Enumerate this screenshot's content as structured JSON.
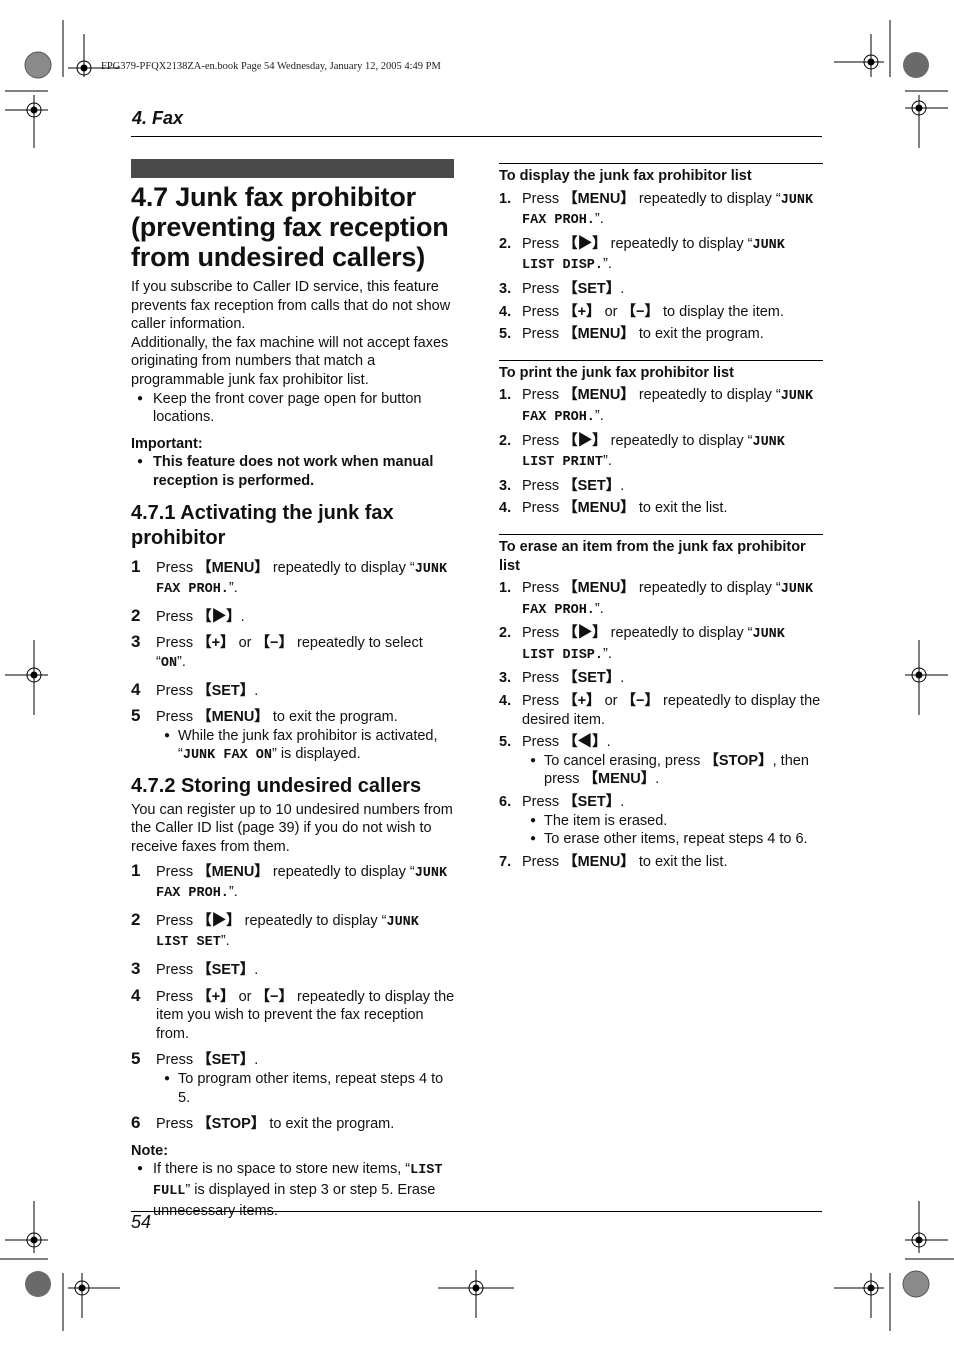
{
  "slug": "FPG379-PFQX2138ZA-en.book  Page 54  Wednesday, January 12, 2005  4:49 PM",
  "chapter": "4. Fax",
  "page_number": "54",
  "section": {
    "title": "4.7 Junk fax prohibitor (preventing fax reception from undesired callers)",
    "intro1": "If you subscribe to Caller ID service, this feature prevents fax reception from calls that do not show caller information.",
    "intro2": "Additionally, the fax machine will not accept faxes originating from numbers that match a programmable junk fax prohibitor list.",
    "bullet": "Keep the front cover page open for button locations.",
    "important_label": "Important:",
    "important_text": "This feature does not work when manual reception is performed."
  },
  "sub1": {
    "title": "4.7.1 Activating the junk fax prohibitor",
    "steps": [
      {
        "n": "1",
        "a": "Press ",
        "k": "【MENU】",
        "b": " repeatedly to display “",
        "lcd": "JUNK FAX PROH.",
        "c": "”."
      },
      {
        "n": "2",
        "a": "Press ",
        "k": "【▶】",
        "b": ".",
        "lcd": "",
        "c": ""
      },
      {
        "n": "3",
        "a": "Press ",
        "k": "【+】",
        "b": " or ",
        "k2": "【−】",
        "b2": " repeatedly to select “",
        "lcd": "ON",
        "c": "”."
      },
      {
        "n": "4",
        "a": "Press ",
        "k": "【SET】",
        "b": ".",
        "lcd": "",
        "c": ""
      },
      {
        "n": "5",
        "a": "Press ",
        "k": "【MENU】",
        "b": " to exit the program.",
        "lcd": "",
        "c": ""
      }
    ],
    "step5_note_a": "While the junk fax prohibitor is activated, “",
    "step5_note_lcd": "JUNK FAX ON",
    "step5_note_b": "” is displayed."
  },
  "sub2": {
    "title": "4.7.2 Storing undesired callers",
    "intro": "You can register up to 10 undesired numbers from the Caller ID list (page 39) if you do not wish to receive faxes from them.",
    "steps": [
      {
        "n": "1",
        "a": "Press ",
        "k": "【MENU】",
        "b": " repeatedly to display “",
        "lcd": "JUNK FAX PROH.",
        "c": "”."
      },
      {
        "n": "2",
        "a": "Press ",
        "k": "【▶】",
        "b": " repeatedly to display “",
        "lcd": "JUNK LIST SET",
        "c": "”."
      },
      {
        "n": "3",
        "a": "Press ",
        "k": "【SET】",
        "b": ".",
        "lcd": "",
        "c": ""
      },
      {
        "n": "4",
        "a": "Press ",
        "k": "【+】",
        "b": " or ",
        "k2": "【−】",
        "b2": " repeatedly to display the item you wish to prevent the fax reception from.",
        "lcd": "",
        "c": ""
      },
      {
        "n": "5",
        "a": "Press ",
        "k": "【SET】",
        "b": ".",
        "lcd": "",
        "c": ""
      },
      {
        "n": "6",
        "a": "Press ",
        "k": "【STOP】",
        "b": " to exit the program.",
        "lcd": "",
        "c": ""
      }
    ],
    "step5_note": "To program other items, repeat steps 4 to 5.",
    "note_label": "Note:",
    "note_a": "If there is no space to store new items, “",
    "note_lcd": "LIST FULL",
    "note_b": "” is displayed in step 3 or step 5. Erase unnecessary items."
  },
  "display_list": {
    "title": "To display the junk fax prohibitor list",
    "steps": [
      {
        "n": "1.",
        "a": "Press ",
        "k": "【MENU】",
        "b": " repeatedly to display “",
        "lcd": "JUNK FAX PROH.",
        "c": "”."
      },
      {
        "n": "2.",
        "a": "Press ",
        "k": "【▶】",
        "b": " repeatedly to display “",
        "lcd": "JUNK LIST DISP.",
        "c": "”."
      },
      {
        "n": "3.",
        "a": "Press ",
        "k": "【SET】",
        "b": ".",
        "lcd": "",
        "c": ""
      },
      {
        "n": "4.",
        "a": "Press ",
        "k": "【+】",
        "b": " or ",
        "k2": "【−】",
        "b2": " to display the item.",
        "lcd": "",
        "c": ""
      },
      {
        "n": "5.",
        "a": "Press ",
        "k": "【MENU】",
        "b": " to exit the program.",
        "lcd": "",
        "c": ""
      }
    ]
  },
  "print_list": {
    "title": "To print the junk fax prohibitor list",
    "steps": [
      {
        "n": "1.",
        "a": "Press ",
        "k": "【MENU】",
        "b": " repeatedly to display “",
        "lcd": "JUNK FAX PROH.",
        "c": "”."
      },
      {
        "n": "2.",
        "a": "Press ",
        "k": "【▶】",
        "b": " repeatedly to display “",
        "lcd": "JUNK LIST PRINT",
        "c": "”."
      },
      {
        "n": "3.",
        "a": "Press ",
        "k": "【SET】",
        "b": ".",
        "lcd": "",
        "c": ""
      },
      {
        "n": "4.",
        "a": "Press ",
        "k": "【MENU】",
        "b": " to exit the list.",
        "lcd": "",
        "c": ""
      }
    ]
  },
  "erase_item": {
    "title": "To erase an item from the junk fax prohibitor list",
    "steps": [
      {
        "n": "1.",
        "a": "Press ",
        "k": "【MENU】",
        "b": " repeatedly to display “",
        "lcd": "JUNK FAX PROH.",
        "c": "”."
      },
      {
        "n": "2.",
        "a": "Press ",
        "k": "【▶】",
        "b": " repeatedly to display “",
        "lcd": "JUNK LIST DISP.",
        "c": "”."
      },
      {
        "n": "3.",
        "a": "Press ",
        "k": "【SET】",
        "b": ".",
        "lcd": "",
        "c": ""
      },
      {
        "n": "4.",
        "a": "Press ",
        "k": "【+】",
        "b": " or ",
        "k2": "【−】",
        "b2": " repeatedly to display the desired item.",
        "lcd": "",
        "c": ""
      },
      {
        "n": "5.",
        "a": "Press ",
        "k": "【◀】",
        "b": ".",
        "lcd": "",
        "c": ""
      },
      {
        "n": "6.",
        "a": "Press ",
        "k": "【SET】",
        "b": ".",
        "lcd": "",
        "c": ""
      },
      {
        "n": "7.",
        "a": "Press ",
        "k": "【MENU】",
        "b": " to exit the list.",
        "lcd": "",
        "c": ""
      }
    ],
    "step5_note_a": "To cancel erasing, press ",
    "step5_note_k": "【STOP】",
    "step5_note_b": ", then press ",
    "step5_note_k2": "【MENU】",
    "step5_note_c": ".",
    "step6_notes": [
      "The item is erased.",
      "To erase other items, repeat steps 4 to 6."
    ]
  }
}
